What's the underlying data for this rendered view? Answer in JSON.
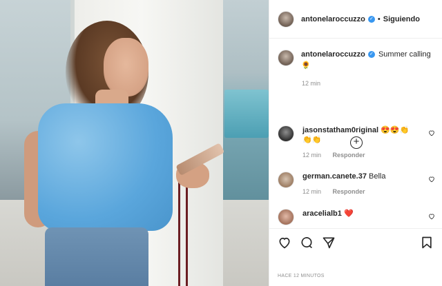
{
  "post": {
    "author": "antonelaroccuzzo",
    "follow_separator": "•",
    "follow_label": "Siguiendo",
    "caption_text": "Summer calling",
    "caption_emoji": "🌻",
    "caption_time": "12 min",
    "timestamp": "HACE 12 MINUTOS"
  },
  "comments": [
    {
      "user": "jasonstatham0riginal",
      "text": "😍😍👏",
      "text2": "👏👏",
      "time": "12 min",
      "reply_label": "Responder"
    },
    {
      "user": "german.canete.37",
      "text": "Bella",
      "time": "12 min",
      "reply_label": "Responder"
    },
    {
      "user": "aracelialb1",
      "text": "❤️"
    }
  ],
  "icons": {
    "verified": "verified-badge-icon",
    "load_more": "plus-circle-icon",
    "like": "heart-icon",
    "comment": "comment-bubble-icon",
    "share": "paper-plane-icon",
    "save": "bookmark-icon"
  },
  "colors": {
    "verified": "#3897f0",
    "muted": "#8e8e8e",
    "text": "#262626"
  }
}
